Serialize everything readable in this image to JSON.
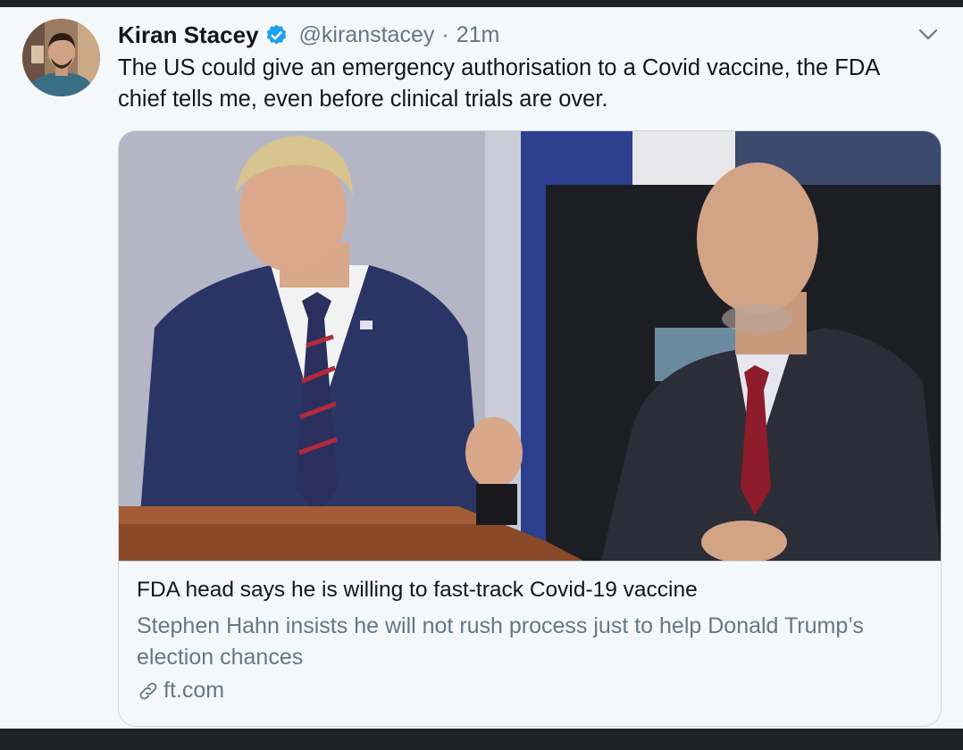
{
  "tweet": {
    "author_name": "Kiran Stacey",
    "handle": "@kiranstacey",
    "separator": "·",
    "time": "21m",
    "text": "The US could give an emergency authorisation to a Covid vaccine, the FDA chief tells me, even before clinical trials are over."
  },
  "card": {
    "title": "FDA head says he is willing to fast-track Covid-19 vaccine",
    "description": "Stephen Hahn insists he will not rush process just to help Donald Trump’s election chances",
    "domain": "ft.com"
  },
  "icons": {
    "verified": "verified-badge-icon",
    "caret": "chevron-down-icon",
    "link": "link-icon"
  },
  "colors": {
    "background": "#f5f8fa",
    "text": "#14171a",
    "secondary_text": "#657786",
    "verified_blue": "#1da1f2",
    "border": "#ccd6dd"
  }
}
